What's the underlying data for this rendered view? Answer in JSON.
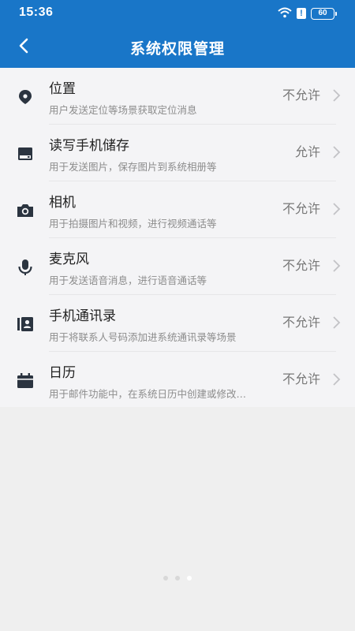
{
  "status_bar": {
    "time": "15:36",
    "alert": "!",
    "battery": "60",
    "icons": [
      "wifi-icon",
      "alert-icon",
      "battery-icon"
    ]
  },
  "nav": {
    "title": "系统权限管理",
    "back_icon": "chevron-left-icon"
  },
  "permissions": [
    {
      "title": "位置",
      "desc": "用户发送定位等场景获取定位消息",
      "status": "不允许",
      "icon": "location-pin-icon"
    },
    {
      "title": "读写手机储存",
      "desc": "用于发送图片，保存图片到系统相册等",
      "status": "允许",
      "icon": "storage-icon"
    },
    {
      "title": "相机",
      "desc": "用于拍摄图片和视频，进行视频通话等",
      "status": "不允许",
      "icon": "camera-icon"
    },
    {
      "title": "麦克风",
      "desc": "用于发送语音消息，进行语音通话等",
      "status": "不允许",
      "icon": "microphone-icon"
    },
    {
      "title": "手机通讯录",
      "desc": "用于将联系人号码添加进系统通讯录等场景",
      "status": "不允许",
      "icon": "contacts-icon"
    },
    {
      "title": "日历",
      "desc": "用于邮件功能中，在系统日历中创建或修改…",
      "status": "不允许",
      "icon": "calendar-icon"
    }
  ],
  "page_indicator": {
    "total": 3,
    "active": 3
  },
  "colors": {
    "header": "#1976c8",
    "list_bg": "#f4f4f6",
    "page_bg": "#efefef",
    "icon": "#2b3440"
  }
}
